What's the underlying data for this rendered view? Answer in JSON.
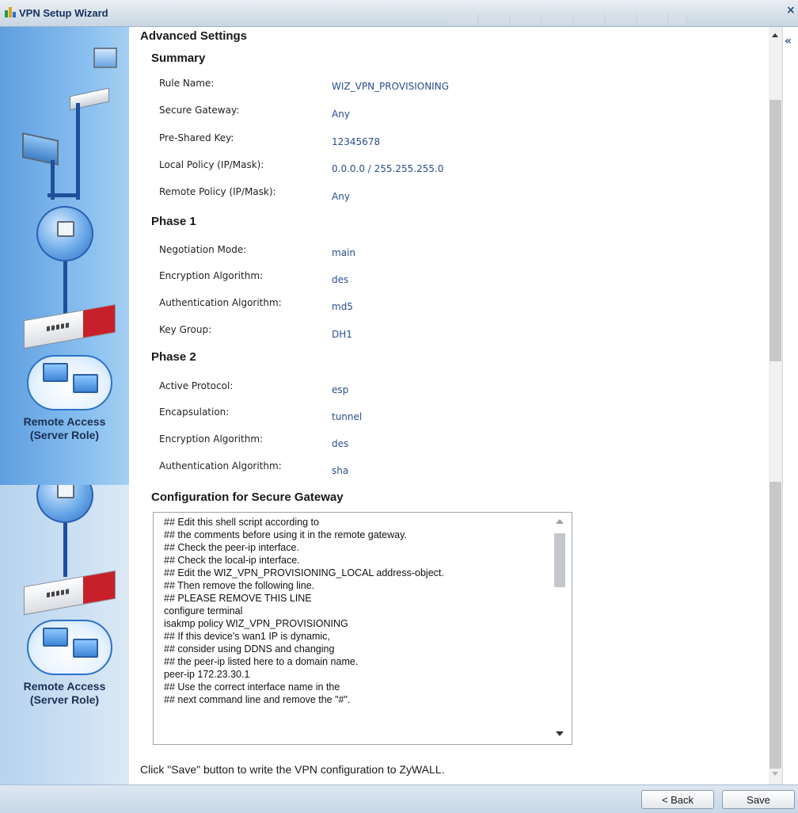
{
  "window": {
    "title": "VPN Setup Wizard",
    "close_glyph": "×",
    "collapse_glyph": "«"
  },
  "left_panel": {
    "role_label_1": "Remote Access\n(Server Role)",
    "role_label_2": "Remote Access\n(Server Role)"
  },
  "main": {
    "heading": "Advanced Settings",
    "summary": {
      "title": "Summary",
      "rows": [
        {
          "label": "Rule Name:",
          "value": "WIZ_VPN_PROVISIONING"
        },
        {
          "label": "Secure Gateway:",
          "value": "Any"
        },
        {
          "label": "Pre-Shared Key:",
          "value": "12345678"
        },
        {
          "label": "Local Policy (IP/Mask):",
          "value": "0.0.0.0 / 255.255.255.0"
        },
        {
          "label": "Remote Policy (IP/Mask):",
          "value": "Any"
        }
      ]
    },
    "phase1": {
      "title": "Phase 1",
      "rows": [
        {
          "label": "Negotiation Mode:",
          "value": "main"
        },
        {
          "label": "Encryption Algorithm:",
          "value": "des"
        },
        {
          "label": "Authentication Algorithm:",
          "value": "md5"
        },
        {
          "label": "Key Group:",
          "value": "DH1"
        }
      ]
    },
    "phase2": {
      "title": "Phase 2",
      "rows": [
        {
          "label": "Active Protocol:",
          "value": "esp"
        },
        {
          "label": "Encapsulation:",
          "value": "tunnel"
        },
        {
          "label": "Encryption Algorithm:",
          "value": "des"
        },
        {
          "label": "Authentication Algorithm:",
          "value": "sha"
        }
      ]
    },
    "config": {
      "title": "Configuration for Secure Gateway",
      "lines": [
        "## Edit this shell script according to",
        "## the comments before using it in the remote gateway.",
        "## Check the peer-ip interface.",
        "## Check the local-ip interface.",
        "## Edit the WIZ_VPN_PROVISIONING_LOCAL address-object.",
        "## Then remove the following line.",
        "## PLEASE REMOVE THIS LINE",
        "configure terminal",
        "isakmp policy WIZ_VPN_PROVISIONING",
        "## If this device's wan1 IP is dynamic,",
        "## consider using DDNS and changing",
        "## the peer-ip listed here to a domain name.",
        "peer-ip 172.23.30.1",
        "## Use the correct interface name in the",
        "## next command line and remove the \"#\"."
      ]
    },
    "note": "Click \"Save\" button to write the VPN configuration to ZyWALL."
  },
  "footer": {
    "back_label": "< Back",
    "save_label": "Save"
  },
  "icons": {
    "app": "vpn-wizard-icon",
    "close": "close-icon",
    "collapse": "collapse-icon",
    "scroll_up": "scroll-up-arrow-icon",
    "scroll_down": "scroll-down-arrow-icon"
  },
  "colors": {
    "value_text": "#2a4d8f",
    "titlebar": "#c9d6e3",
    "panel_blue": "#5f9ee0",
    "router_red": "#c8202a"
  }
}
